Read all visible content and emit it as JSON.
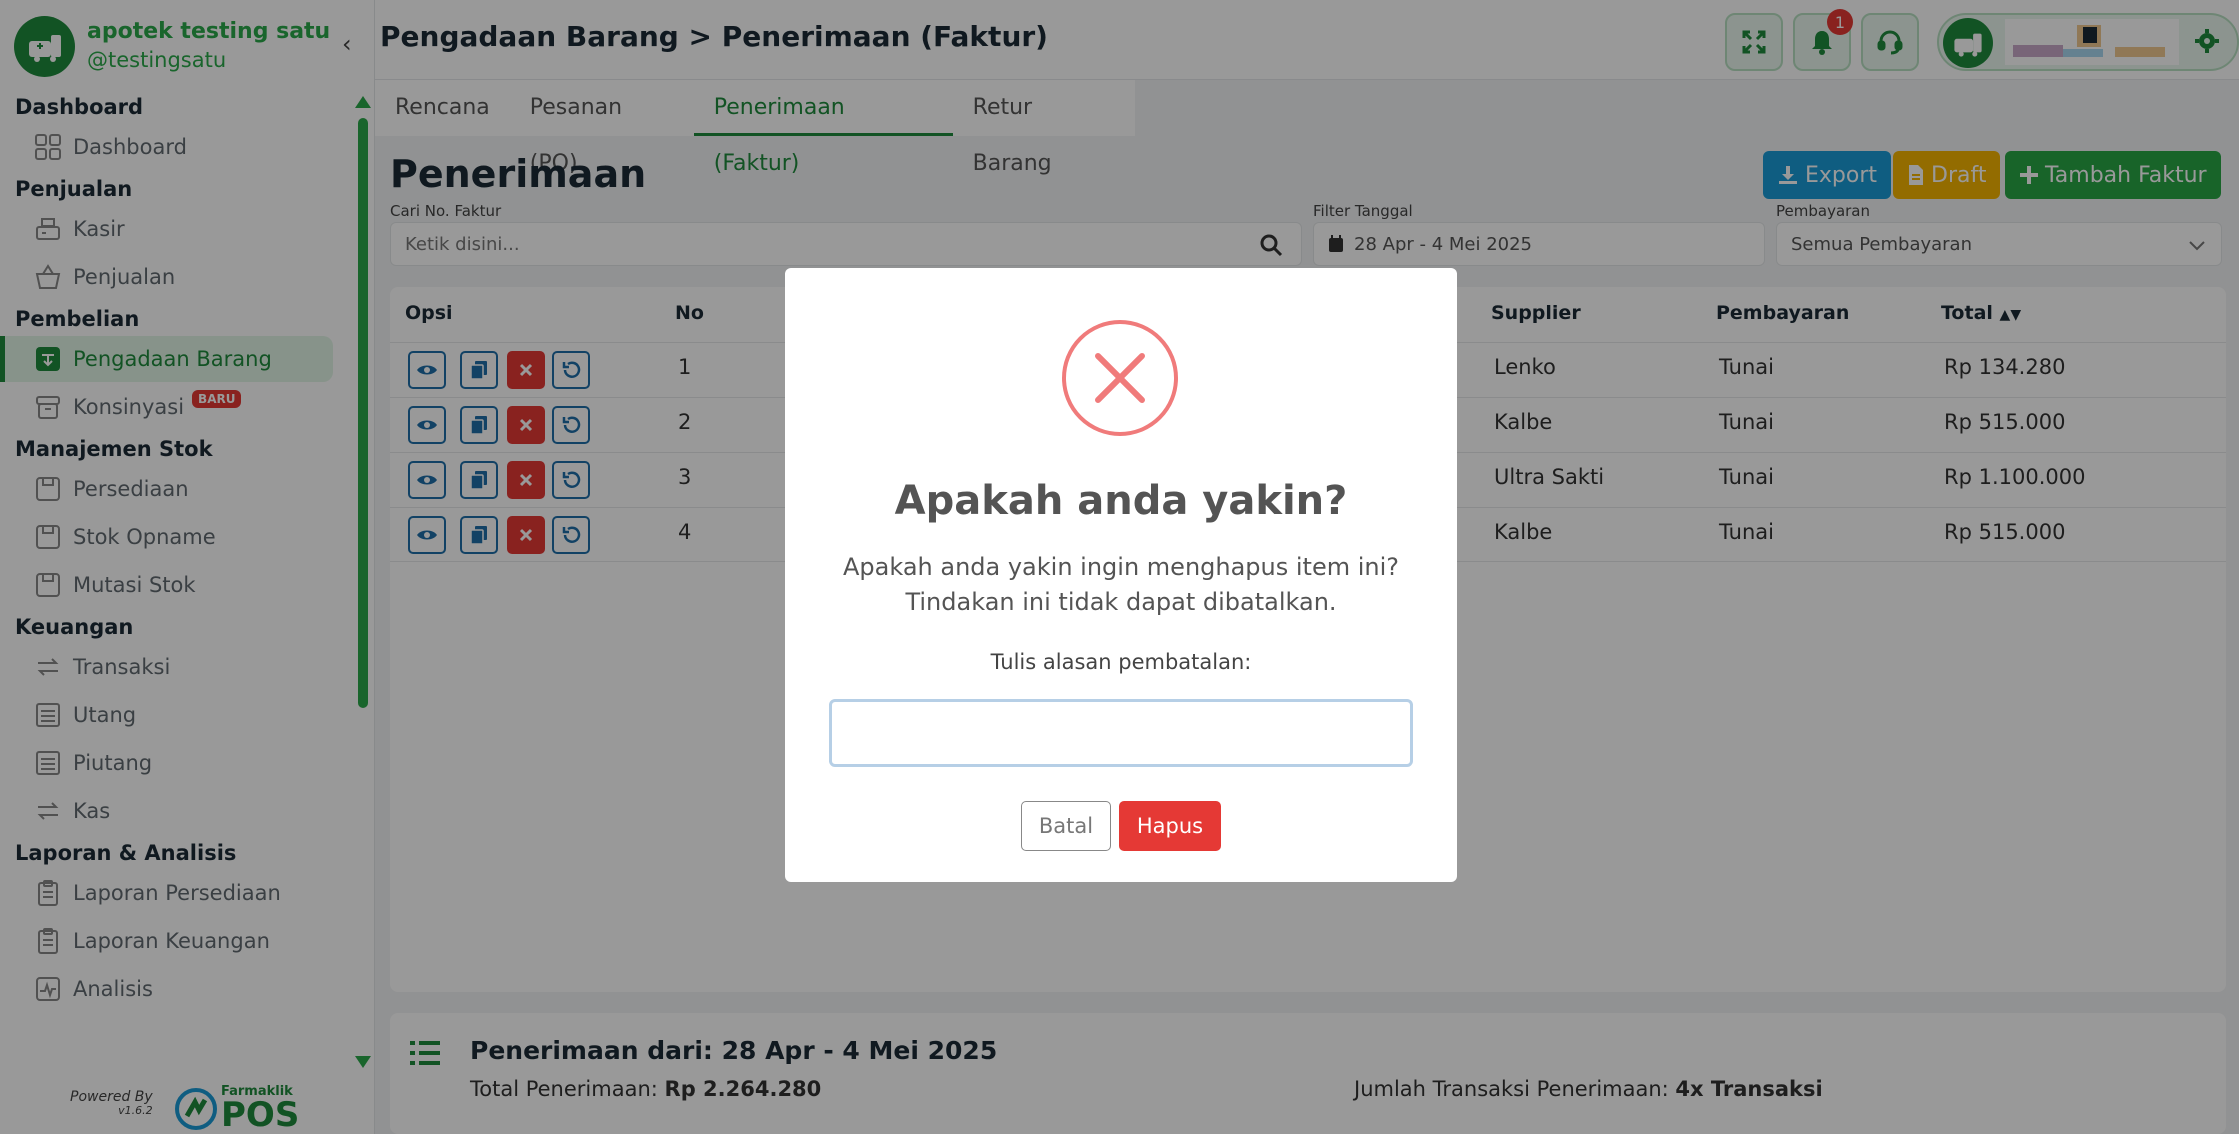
{
  "brand": {
    "name": "apotek testing satu",
    "handle": "@testingsatu"
  },
  "sidebar": {
    "sections": [
      {
        "title": "Dashboard",
        "items": [
          {
            "label": "Dashboard",
            "icon": "grid-icon"
          }
        ]
      },
      {
        "title": "Penjualan",
        "items": [
          {
            "label": "Kasir",
            "icon": "cash-register-icon"
          },
          {
            "label": "Penjualan",
            "icon": "basket-icon"
          }
        ]
      },
      {
        "title": "Pembelian",
        "items": [
          {
            "label": "Pengadaan Barang",
            "icon": "procurement-icon",
            "active": true
          },
          {
            "label": "Konsinyasi",
            "icon": "archive-icon",
            "badge": "BARU"
          }
        ]
      },
      {
        "title": "Manajemen Stok",
        "items": [
          {
            "label": "Persediaan",
            "icon": "box-icon"
          },
          {
            "label": "Stok Opname",
            "icon": "box-icon"
          },
          {
            "label": "Mutasi Stok",
            "icon": "box-icon"
          }
        ]
      },
      {
        "title": "Keuangan",
        "items": [
          {
            "label": "Transaksi",
            "icon": "transfer-icon"
          },
          {
            "label": "Utang",
            "icon": "ledger-icon"
          },
          {
            "label": "Piutang",
            "icon": "ledger-icon"
          },
          {
            "label": "Kas",
            "icon": "transfer-icon"
          }
        ]
      },
      {
        "title": "Laporan & Analisis",
        "items": [
          {
            "label": "Laporan Persediaan",
            "icon": "clipboard-icon"
          },
          {
            "label": "Laporan Keuangan",
            "icon": "clipboard-icon"
          },
          {
            "label": "Analisis",
            "icon": "chart-icon"
          }
        ]
      }
    ],
    "powered_by": "Powered By",
    "version": "v1.6.2",
    "pos_brand_small": "Farmaklik",
    "pos_brand_big": "POS"
  },
  "header": {
    "breadcrumb": "Pengadaan Barang > Penerimaan (Faktur)",
    "notification_count": "1"
  },
  "tabs": [
    {
      "label": "Rencana",
      "active": false
    },
    {
      "label": "Pesanan (PO)",
      "active": false
    },
    {
      "label": "Penerimaan (Faktur)",
      "active": true
    },
    {
      "label": "Retur Barang",
      "active": false
    }
  ],
  "main": {
    "title": "Penerimaan",
    "buttons": {
      "export": "Export",
      "draft": "Draft",
      "add": "Tambah Faktur"
    },
    "search": {
      "label": "Cari No. Faktur",
      "placeholder": "Ketik disini..."
    },
    "date_filter": {
      "label": "Filter Tanggal",
      "value": "28 Apr - 4 Mei 2025"
    },
    "payment_filter": {
      "label": "Pembayaran",
      "value": "Semua Pembayaran"
    }
  },
  "table": {
    "columns": {
      "options": "Opsi",
      "no": "No",
      "supplier": "Supplier",
      "payment": "Pembayaran",
      "total": "Total"
    },
    "rows": [
      {
        "no": "1",
        "supplier": "Lenko",
        "payment": "Tunai",
        "total": "Rp 134.280"
      },
      {
        "no": "2",
        "supplier": "Kalbe",
        "payment": "Tunai",
        "total": "Rp 515.000"
      },
      {
        "no": "3",
        "supplier": "Ultra Sakti",
        "payment": "Tunai",
        "total": "Rp 1.100.000"
      },
      {
        "no": "4",
        "supplier": "Kalbe",
        "payment": "Tunai",
        "total": "Rp 515.000"
      }
    ]
  },
  "summary": {
    "title": "Penerimaan dari: 28 Apr - 4 Mei 2025",
    "total_label": "Total Penerimaan:",
    "total_value": "Rp 2.264.280",
    "count_label": "Jumlah Transaksi Penerimaan:",
    "count_value": "4x Transaksi"
  },
  "modal": {
    "title": "Apakah anda yakin?",
    "text_line1": "Apakah anda yakin ingin menghapus item ini?",
    "text_line2": "Tindakan ini tidak dapat dibatalkan.",
    "reason_label": "Tulis alasan pembatalan:",
    "reason_value": "",
    "cancel_label": "Batal",
    "confirm_label": "Hapus"
  },
  "colors": {
    "brand_green": "#1f8a3c",
    "export_blue": "#1a9bd7",
    "draft_yellow": "#f5b400",
    "danger_red": "#e53935"
  }
}
